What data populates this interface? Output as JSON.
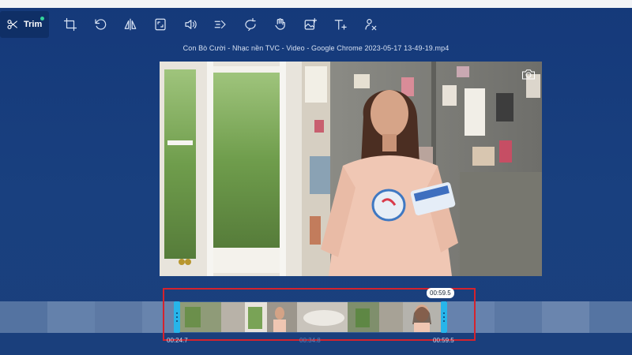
{
  "toolbar": {
    "trim_label": "Trim",
    "tools": [
      {
        "icon": "crop-icon"
      },
      {
        "icon": "rotate-icon"
      },
      {
        "icon": "flip-icon"
      },
      {
        "icon": "aspect-ratio-icon"
      },
      {
        "icon": "volume-icon"
      },
      {
        "icon": "speed-icon"
      },
      {
        "icon": "loop-icon"
      },
      {
        "icon": "stabilize-icon"
      },
      {
        "icon": "add-image-icon"
      },
      {
        "icon": "add-text-icon"
      },
      {
        "icon": "watermark-remove-icon"
      }
    ]
  },
  "file_title": "Con Bò Cười - Nhạc nền TVC - Video - Google Chrome 2023-05-17 13-49-19.mp4",
  "timeline": {
    "end_badge": "00:59.5",
    "start_time": "00:24.7",
    "duration": "00:34.8",
    "end_time": "00:59.5"
  },
  "colors": {
    "background": "#173f7e",
    "selection_border": "#d4232d",
    "handle": "#27b5ea",
    "trim_active_dot": "#33d49a"
  }
}
